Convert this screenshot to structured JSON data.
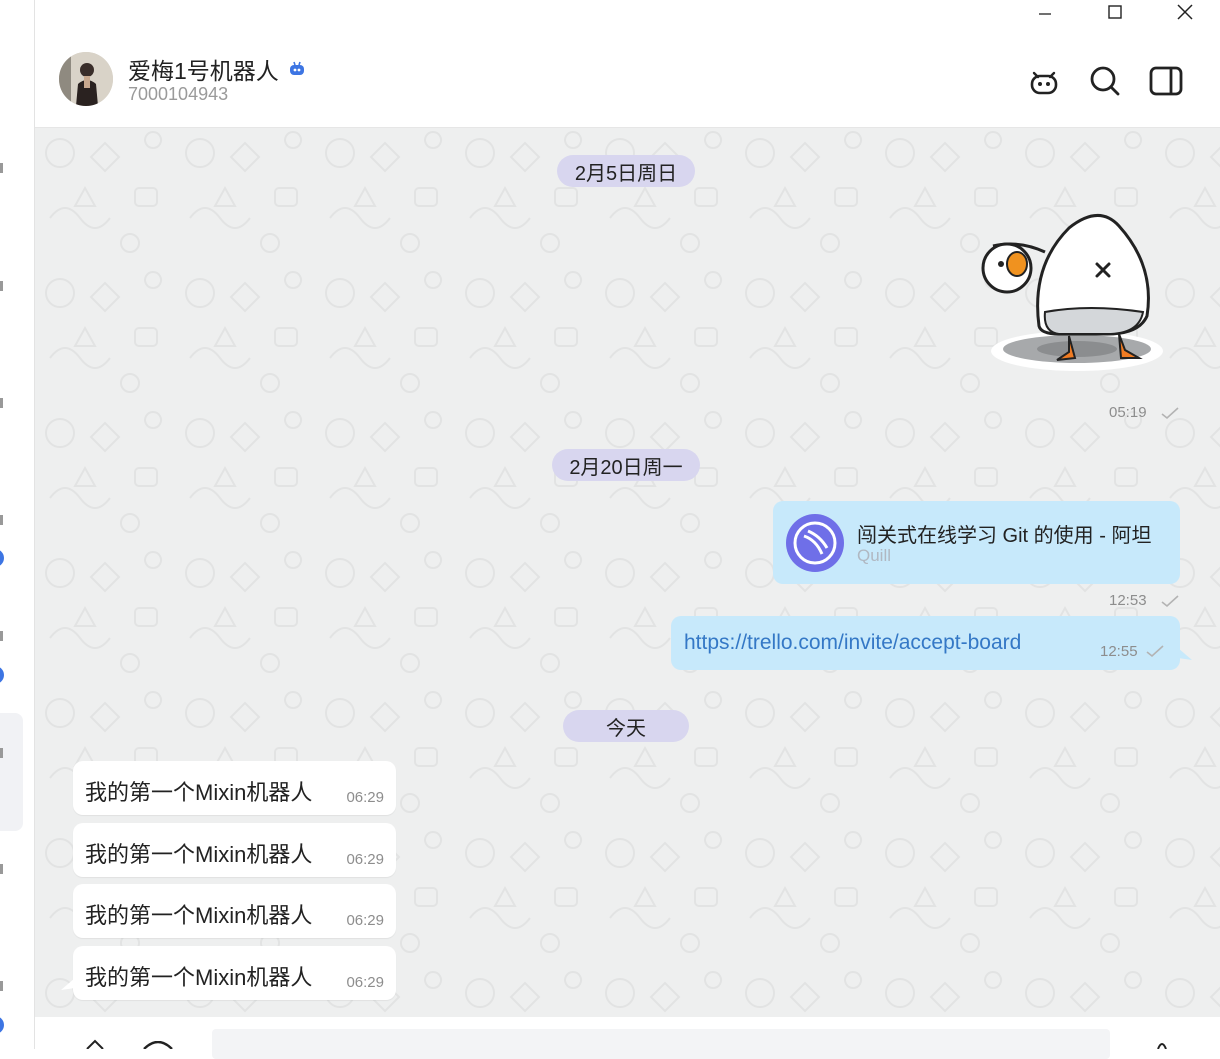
{
  "window": {
    "minimize_icon": "minimize-icon",
    "maximize_icon": "maximize-icon",
    "close_icon": "close-icon"
  },
  "header": {
    "title": "爱梅1号机器人",
    "subtitle": "7000104943",
    "icons": [
      "bot-icon",
      "search-icon",
      "sidebar-icon"
    ]
  },
  "messages": {
    "date1": "2月5日周日",
    "sticker_time": "05:19",
    "date2": "2月20日周一",
    "link_card": {
      "title": "闯关式在线学习 Git 的使用 - 阿坦",
      "source": "Quill",
      "time": "12:53"
    },
    "url": {
      "text": "https://trello.com/invite/accept-board",
      "time": "12:55"
    },
    "date3": "今天",
    "incoming": [
      {
        "text": "我的第一个Mixin机器人",
        "time": "06:29"
      },
      {
        "text": "我的第一个Mixin机器人",
        "time": "06:29"
      },
      {
        "text": "我的第一个Mixin机器人",
        "time": "06:29"
      },
      {
        "text": "我的第一个Mixin机器人",
        "time": "06:29"
      }
    ]
  },
  "colors": {
    "accent": "#3d75e3",
    "outgoing_bubble": "#c7e9fb",
    "date_pill": "#d8d6ef",
    "chat_bg": "#eeefef",
    "link": "#3478c6"
  }
}
